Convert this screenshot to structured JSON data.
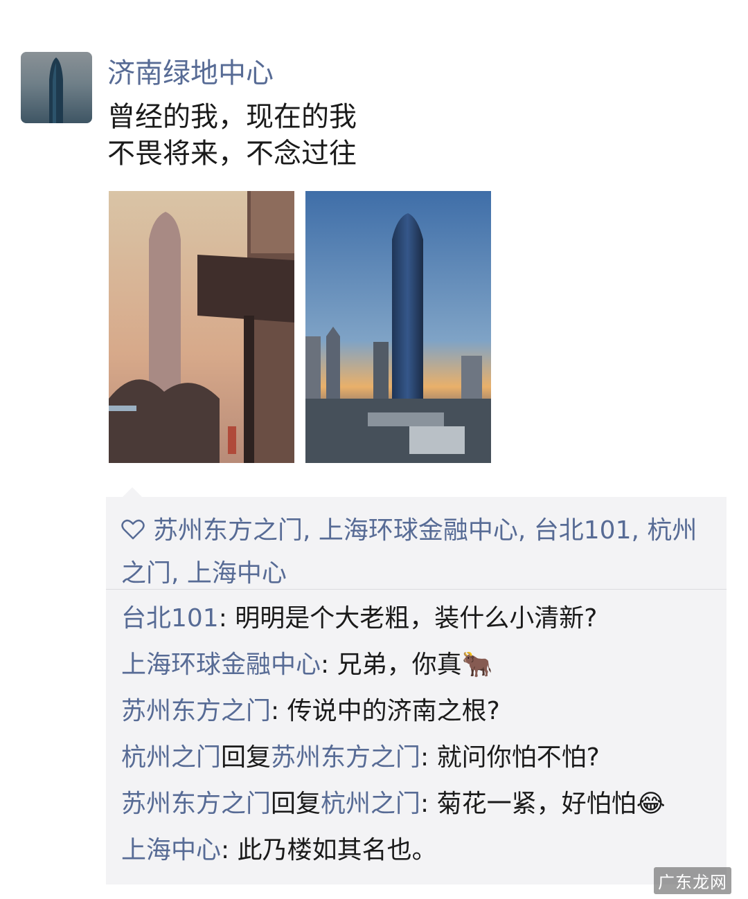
{
  "post": {
    "author": "济南绿地中心",
    "text_lines": [
      "曾经的我，现在的我",
      "不畏将来，不念过往"
    ],
    "photos": [
      {
        "label": "photo-then"
      },
      {
        "label": "photo-now"
      }
    ]
  },
  "likes": {
    "icon": "heart-icon",
    "names": "苏州东方之门, 上海环球金融中心, 台北101, 杭州之门, 上海中心"
  },
  "comments": [
    {
      "name": "台北101",
      "text": ": 明明是个大老粗，装什么小清新?",
      "emoji": ""
    },
    {
      "name": "上海环球金融中心",
      "text": ": 兄弟，你真",
      "emoji": "🐂"
    },
    {
      "name": "苏州东方之门",
      "text": ": 传说中的济南之根?",
      "emoji": ""
    },
    {
      "name": "杭州之门",
      "reply_word": "回复",
      "reply_to": "苏州东方之门",
      "text": ": 就问你怕不怕?",
      "emoji": ""
    },
    {
      "name": "苏州东方之门",
      "reply_word": "回复",
      "reply_to": "杭州之门",
      "text": ": 菊花一紧，好怕怕",
      "emoji": "😂"
    },
    {
      "name": "上海中心",
      "text": ": 此乃楼如其名也。",
      "emoji": ""
    }
  ],
  "watermark": "广东龙网",
  "colors": {
    "name_link": "#576b95",
    "panel_bg": "#f3f3f5",
    "text": "#1a1a1a"
  }
}
